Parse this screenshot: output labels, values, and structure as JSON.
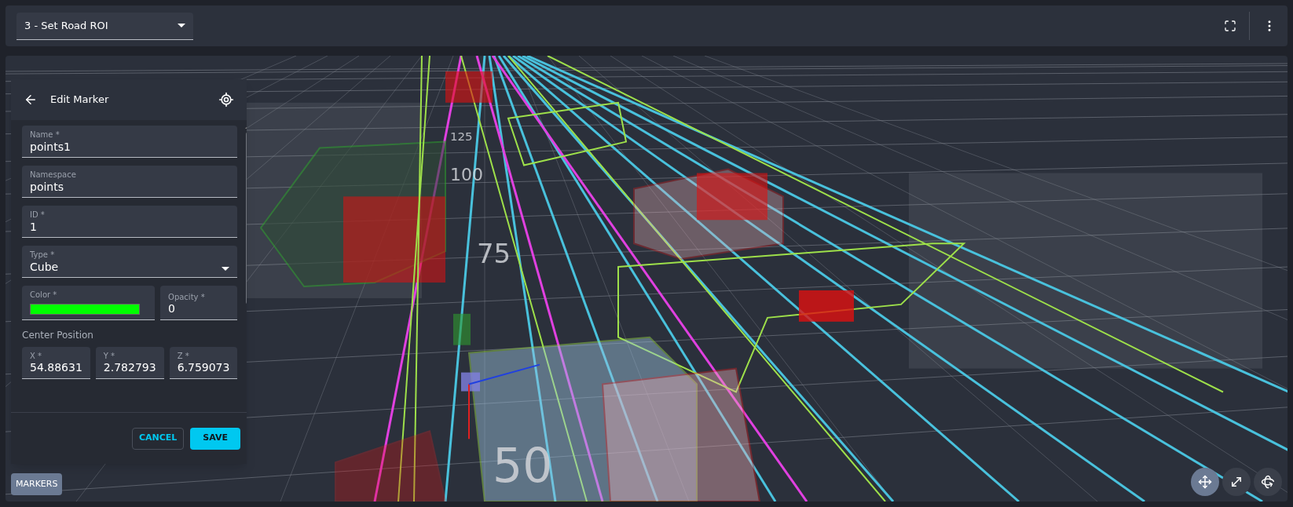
{
  "toolbar": {
    "step_select": {
      "value": "3 - Set Road ROI"
    }
  },
  "viewport": {
    "distance_labels": [
      "125",
      "100",
      "75",
      "50"
    ],
    "markers_button": "MARKERS"
  },
  "editor": {
    "title": "Edit Marker",
    "fields": [
      {
        "kind": "text",
        "label": "Name *",
        "value": "points1"
      },
      {
        "kind": "text",
        "label": "Namespace",
        "value": "points"
      },
      {
        "kind": "text",
        "label": "ID *",
        "value": "1"
      },
      {
        "kind": "select",
        "label": "Type *",
        "value": "Cube"
      }
    ],
    "appearance": [
      {
        "kind": "color",
        "label": "Color *",
        "color": "#00ff00"
      },
      {
        "kind": "text",
        "label": "Opacity *",
        "value": "0"
      }
    ],
    "section": "Center Position",
    "position": [
      {
        "label": "X *",
        "value": "54.88631"
      },
      {
        "label": "Y *",
        "value": "2.782793"
      },
      {
        "label": "Z *",
        "value": "6.759073"
      }
    ],
    "buttons": [
      {
        "kind": "outline",
        "label": "CANCEL"
      },
      {
        "kind": "primary",
        "label": "SAVE"
      }
    ]
  }
}
